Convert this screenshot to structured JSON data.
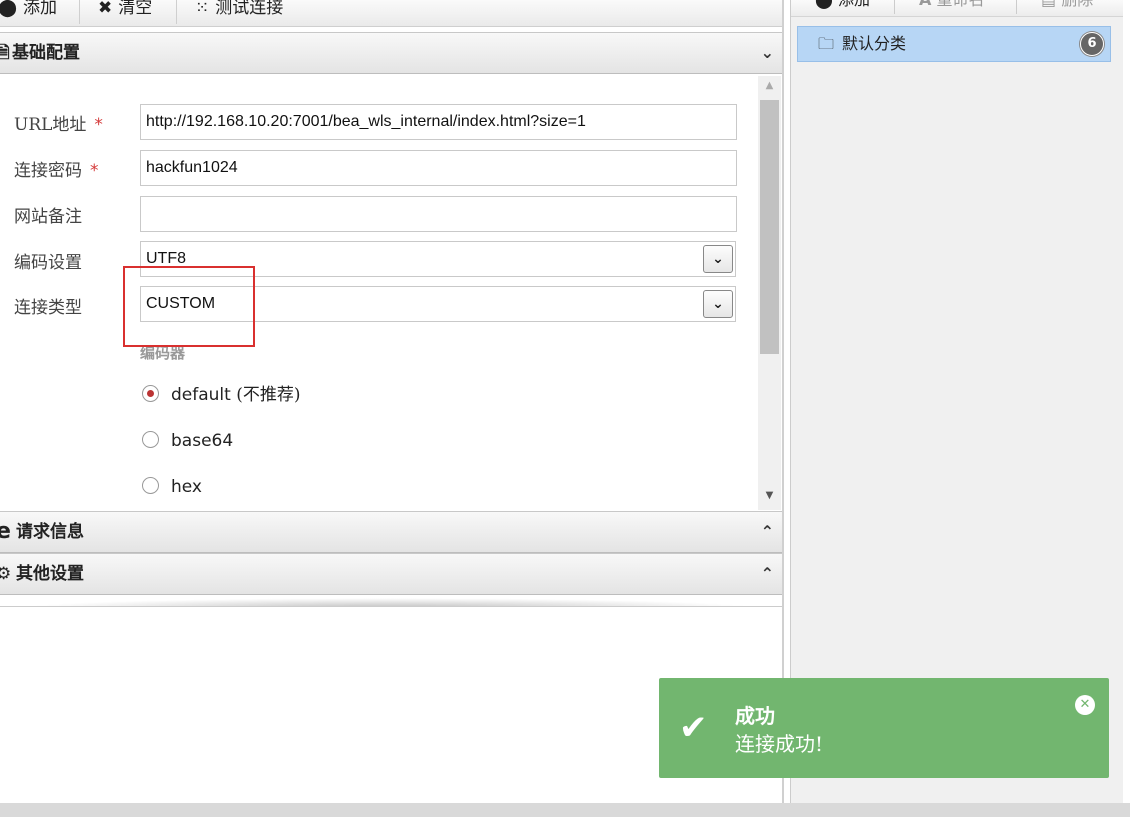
{
  "toolbar": {
    "add_label": "添加",
    "add_icon": "plus-circle-icon",
    "clear_label": "清空",
    "clear_icon": "times-icon",
    "test_label": "测试连接",
    "test_icon": "spinner-icon"
  },
  "sections": {
    "basic": {
      "title": "基础配置",
      "icon": "file-icon"
    },
    "request": {
      "title": "请求信息",
      "icon": "ie-icon"
    },
    "other": {
      "title": "其他设置",
      "icon": "cogs-icon"
    }
  },
  "form": {
    "url_label": "URL地址",
    "url_value": "http://192.168.10.20:7001/bea_wls_internal/index.html?size=1",
    "password_label": "连接密码",
    "password_value": "hackfun1024",
    "note_label": "网站备注",
    "note_value": "",
    "encoding_label": "编码设置",
    "encoding_value": "UTF8",
    "type_label": "连接类型",
    "type_value": "CUSTOM",
    "required_mark": "*",
    "encoder_label": "编码器",
    "encoders": [
      {
        "label": "default",
        "hint": "(不推荐)",
        "checked": true
      },
      {
        "label": "base64",
        "checked": false
      },
      {
        "label": "hex",
        "checked": false
      }
    ]
  },
  "category_panel": {
    "add_label": "添加",
    "rename_label": "重命名",
    "delete_label": "删除",
    "items": [
      {
        "label": "默认分类",
        "count": "6"
      }
    ]
  },
  "toast": {
    "title": "成功",
    "message": "连接成功!",
    "color": "#72b66f"
  },
  "colors": {
    "highlight_box": "#d9302f",
    "selected_item": "#b7d6f5"
  }
}
